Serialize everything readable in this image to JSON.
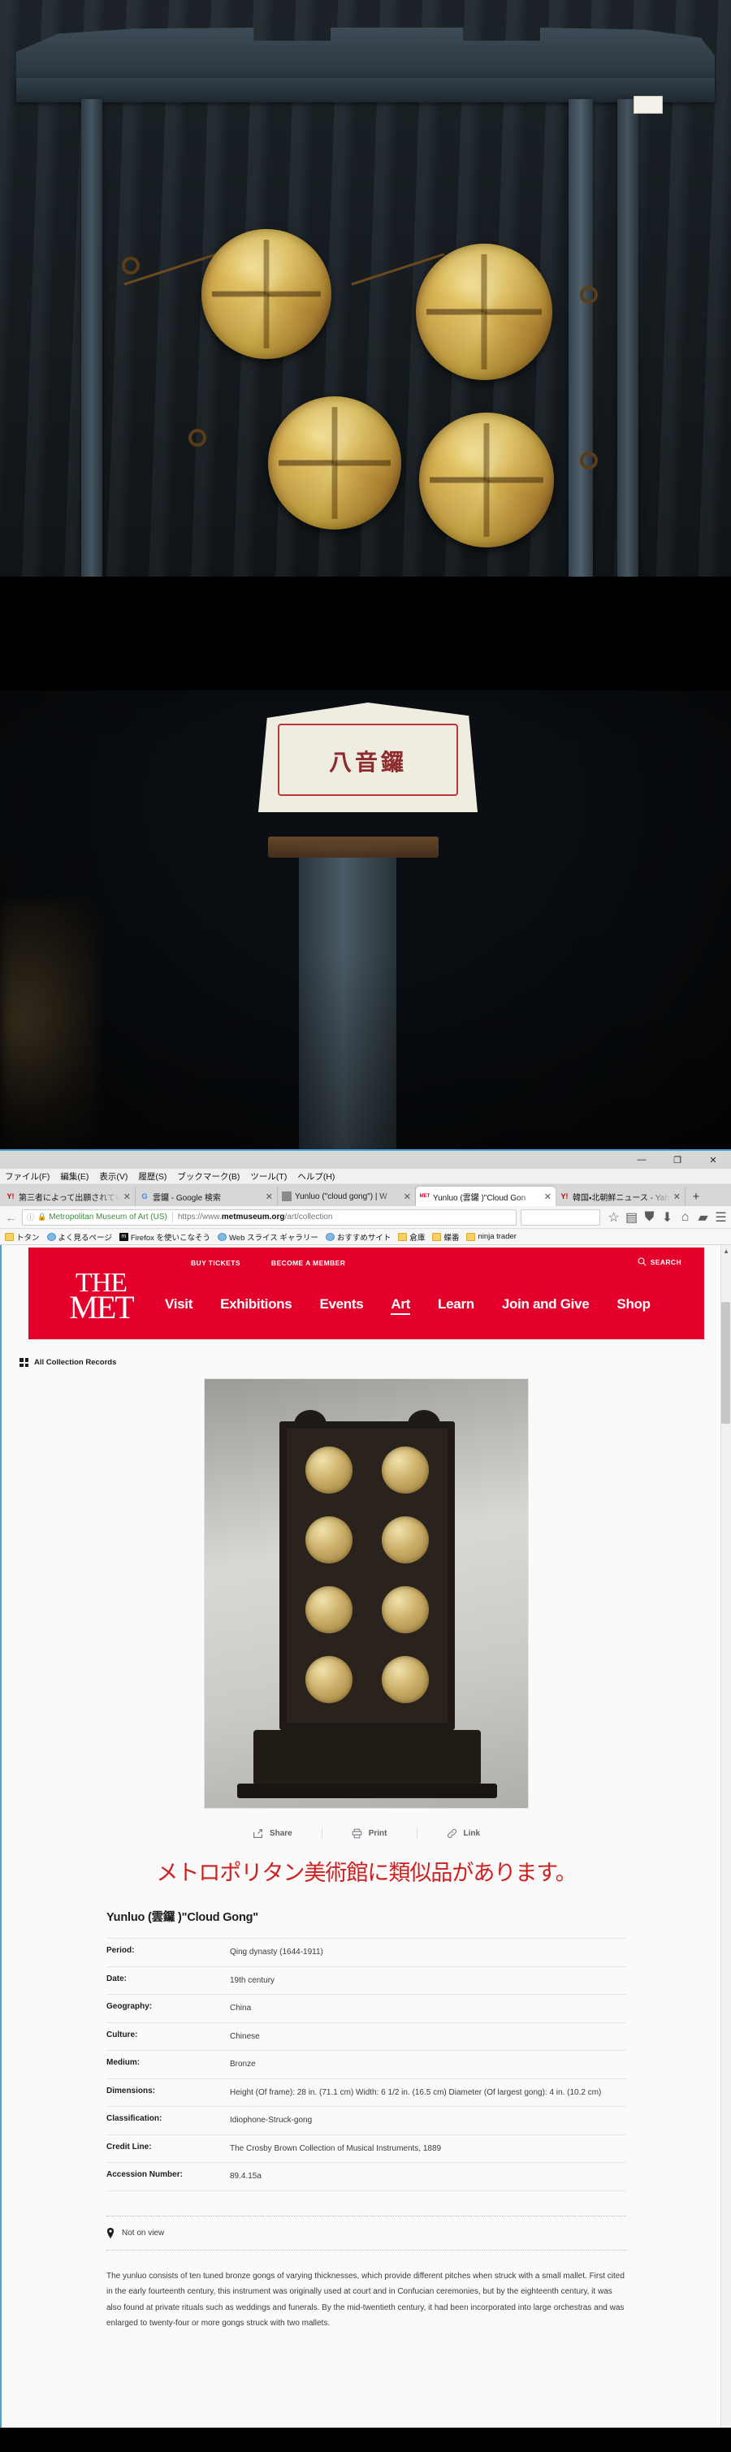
{
  "photos": {
    "top_caption": "bronze gong rack photograph",
    "plaque_text": "八音鑼"
  },
  "browser": {
    "window_controls": {
      "minimize": "—",
      "maximize": "❐",
      "close": "✕"
    },
    "menus": [
      "ファイル(F)",
      "編集(E)",
      "表示(V)",
      "履歴(S)",
      "ブックマーク(B)",
      "ツール(T)",
      "ヘルプ(H)"
    ],
    "tabs": [
      {
        "label": "第三者によって出願されてい",
        "favicon": "Y!",
        "active": false
      },
      {
        "label": "雲鑼 - Google 検索",
        "favicon": "G",
        "active": false
      },
      {
        "label": "Yunluo (\"cloud gong\") | W",
        "favicon": "▣",
        "active": false
      },
      {
        "label": "Yunluo (雲鑼 )\"Cloud Gon",
        "favicon": "MET",
        "active": true
      },
      {
        "label": "韓国・北朝鮮ニュース - Yaho",
        "favicon": "Y!",
        "active": false
      }
    ],
    "new_tab_label": "+",
    "nav": {
      "back": "←",
      "identity_label": "Metropolitan Museum of Art (US)",
      "url_prefix": "https://www.",
      "url_domain": "metmuseum.org",
      "url_path": "/art/collection",
      "search_placeholder": ""
    },
    "toolbar_icons": [
      "star-icon",
      "reader-icon",
      "pocket-icon",
      "download-icon",
      "home-icon",
      "sidebar-icon",
      "menu-icon"
    ],
    "bookmarks": [
      {
        "label": "トタン",
        "icon": "folder"
      },
      {
        "label": "よく見るページ",
        "icon": "globe"
      },
      {
        "label": "Firefox を使いこなそう",
        "icon": "ff"
      },
      {
        "label": "Web スライス ギャラリー",
        "icon": "globe"
      },
      {
        "label": "おすすめサイト",
        "icon": "globe"
      },
      {
        "label": "倉庫",
        "icon": "folder"
      },
      {
        "label": "蝶番",
        "icon": "folder"
      },
      {
        "label": "ninja trader",
        "icon": "folder"
      }
    ]
  },
  "met": {
    "brand_color": "#e4002b",
    "logo_line1": "THE",
    "logo_line2": "MET",
    "utility": [
      "BUY TICKETS",
      "BECOME A MEMBER"
    ],
    "search_label": "SEARCH",
    "nav": [
      {
        "label": "Visit",
        "active": false
      },
      {
        "label": "Exhibitions",
        "active": false
      },
      {
        "label": "Events",
        "active": false
      },
      {
        "label": "Art",
        "active": true
      },
      {
        "label": "Learn",
        "active": false
      },
      {
        "label": "Join and Give",
        "active": false
      },
      {
        "label": "Shop",
        "active": false
      }
    ],
    "breadcrumb": "All Collection Records",
    "actions": [
      {
        "label": "Share",
        "icon": "share-icon"
      },
      {
        "label": "Print",
        "icon": "printer-icon"
      },
      {
        "label": "Link",
        "icon": "link-icon"
      }
    ],
    "annotation": "メトロポリタン美術館に類似品があります。",
    "annotation_color": "#cf2020",
    "object": {
      "title": "Yunluo (雲鑼 )\"Cloud Gong\"",
      "fields": [
        {
          "label": "Period:",
          "value": "Qing dynasty (1644-1911)"
        },
        {
          "label": "Date:",
          "value": "19th century"
        },
        {
          "label": "Geography:",
          "value": "China"
        },
        {
          "label": "Culture:",
          "value": "Chinese"
        },
        {
          "label": "Medium:",
          "value": "Bronze"
        },
        {
          "label": "Dimensions:",
          "value": "Height (Of frame): 28 in. (71.1 cm) Width: 6 1/2 in. (16.5 cm) Diameter (Of largest gong): 4 in. (10.2 cm)"
        },
        {
          "label": "Classification:",
          "value": "Idiophone-Struck-gong"
        },
        {
          "label": "Credit Line:",
          "value": "The Crosby Brown Collection of Musical Instruments, 1889"
        },
        {
          "label": "Accession Number:",
          "value": "89.4.15a"
        }
      ],
      "location_status": "Not on view",
      "description": "The yunluo consists of ten tuned bronze gongs of varying thicknesses, which provide different pitches when struck with a small mallet. First cited in the early fourteenth century, this instrument was originally used at court and in Confucian ceremonies, but by the eighteenth century, it was also found at private rituals such as weddings and funerals. By the mid-twentieth century, it had been incorporated into large orchestras and was enlarged to twenty-four or more gongs struck with two mallets."
    }
  }
}
